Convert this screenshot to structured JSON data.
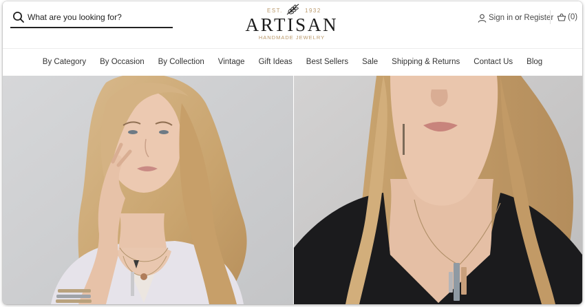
{
  "search": {
    "placeholder": "What are you looking for?"
  },
  "logo": {
    "est": "EST.",
    "year": "1932",
    "name": "ARTISAN",
    "tagline": "HANDMADE JEWELRY"
  },
  "account": {
    "sign_in": "Sign in",
    "or": "or",
    "register": "Register"
  },
  "cart": {
    "count_label": "(0)"
  },
  "nav": {
    "items": [
      {
        "label": "By Category"
      },
      {
        "label": "By Occasion"
      },
      {
        "label": "By Collection"
      },
      {
        "label": "Vintage"
      },
      {
        "label": "Gift Ideas"
      },
      {
        "label": "Best Sellers"
      },
      {
        "label": "Sale"
      },
      {
        "label": "Shipping & Returns"
      },
      {
        "label": "Contact Us"
      },
      {
        "label": "Blog"
      }
    ]
  },
  "colors": {
    "accent_gold": "#b9986a",
    "text_dark": "#1c1c1c",
    "search_underline": "#222222"
  },
  "icons": {
    "search": "search-icon",
    "user": "user-icon",
    "cart": "shopping-basket-icon",
    "logo_leaf": "leaf-sprig-icon"
  }
}
